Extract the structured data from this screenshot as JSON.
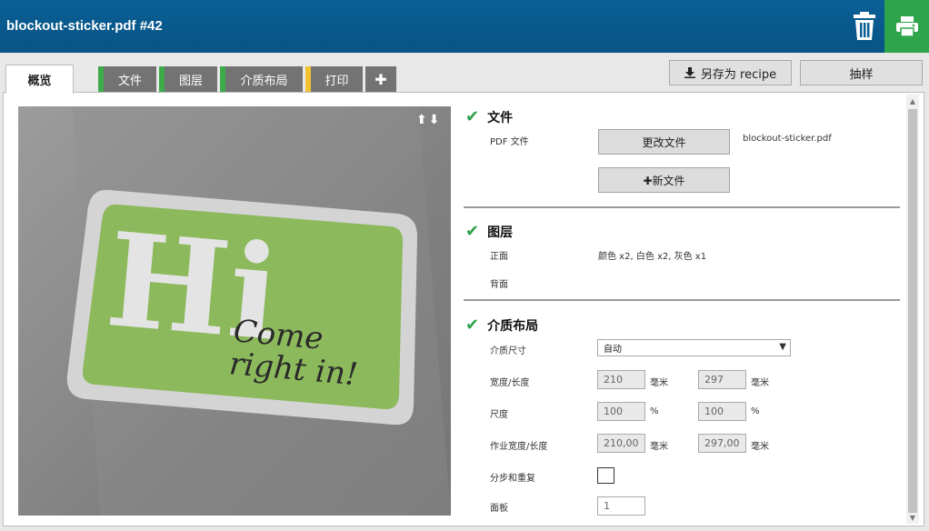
{
  "header": {
    "title": "blockout-sticker.pdf #42"
  },
  "tabs": [
    {
      "label": "概览"
    },
    {
      "label": "文件"
    },
    {
      "label": "图层"
    },
    {
      "label": "介质布局"
    },
    {
      "label": "打印"
    },
    {
      "label": "✚"
    }
  ],
  "toolbar": {
    "save_recipe": "另存为 recipe",
    "sample": "抽样"
  },
  "preview": {
    "arrows": "⬆⬇",
    "sticker_big": "Hi",
    "sticker_line1": "Come",
    "sticker_line2": "right in!"
  },
  "file_section": {
    "title": "文件",
    "pdf_label": "PDF 文件",
    "change_button": "更改文件",
    "filename": "blockout-sticker.pdf",
    "new_button": "✚新文件"
  },
  "layers_section": {
    "title": "图层",
    "front_label": "正面",
    "front_value": "颜色 x2, 白色 x2, 灰色 x1",
    "back_label": "背面"
  },
  "media_section": {
    "title": "介质布局",
    "media_size_label": "介质尺寸",
    "media_size_value": "自动",
    "width_length_label": "宽度/长度",
    "width_value": "210",
    "length_value": "297",
    "mm": "毫米",
    "scale_label": "尺度",
    "scale_x": "100",
    "scale_y": "100",
    "percent": "%",
    "job_width_length_label": "作业宽度/长度",
    "job_width": "210,00",
    "job_length": "297,00",
    "step_repeat_label": "分步和重复",
    "panel_label": "面板",
    "panel_value": "1"
  },
  "colors": {
    "header_blue": "#075485",
    "print_green": "#2ea54a",
    "tab_green": "#3cab4a",
    "tab_yellow": "#f2c230",
    "check_green": "#2fa24a",
    "sticker_green": "#8cb95c"
  }
}
